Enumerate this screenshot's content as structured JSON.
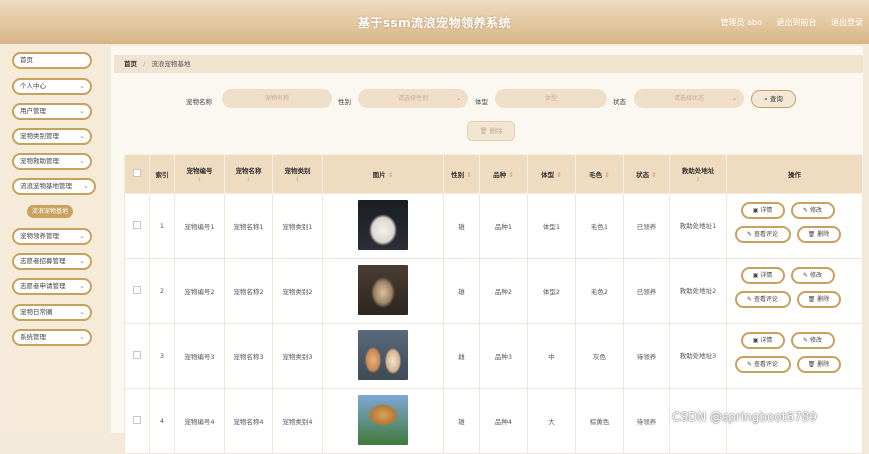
{
  "header": {
    "title": "基于ssm流浪宠物领养系统",
    "links": [
      "管理员 abo",
      "退出到前台",
      "退出登录"
    ]
  },
  "sidebar": {
    "items": [
      {
        "label": "首页",
        "has_chevron": false
      },
      {
        "label": "个人中心",
        "has_chevron": true
      },
      {
        "label": "用户管理",
        "has_chevron": true
      },
      {
        "label": "宠物类别管理",
        "has_chevron": true
      },
      {
        "label": "宠物救助管理",
        "has_chevron": true
      },
      {
        "label": "流浪宠物基地管理",
        "has_chevron": true
      },
      {
        "label": "宠物领养管理",
        "has_chevron": true
      },
      {
        "label": "志愿者招募管理",
        "has_chevron": true
      },
      {
        "label": "志愿者申请管理",
        "has_chevron": true
      },
      {
        "label": "宠物日常圈",
        "has_chevron": true
      },
      {
        "label": "系统管理",
        "has_chevron": true
      }
    ],
    "active_subitem": "流浪宠物基地"
  },
  "breadcrumb": {
    "home": "首页",
    "sep": "/",
    "current": "流浪宠物基地"
  },
  "search": {
    "name_label": "宠物名称",
    "name_placeholder": "宠物名称",
    "gender_label": "性别",
    "gender_placeholder": "请选择性别",
    "size_label": "体型",
    "size_placeholder": "体型",
    "status_label": "状态",
    "status_placeholder": "请选择状态",
    "query_button": "查询"
  },
  "toolbar": {
    "delete_button": "删除"
  },
  "table": {
    "columns": [
      "索引",
      "宠物编号",
      "宠物名称",
      "宠物类别",
      "图片",
      "性别",
      "品种",
      "体型",
      "毛色",
      "状态",
      "救助处地址",
      "操作"
    ],
    "rows": [
      {
        "index": "1",
        "code": "宠物编号1",
        "name": "宠物名称1",
        "category": "宠物类别1",
        "gender": "雄",
        "breed": "品种1",
        "size": "体型1",
        "color": "毛色1",
        "status": "已领养",
        "address": "救助处地址1"
      },
      {
        "index": "2",
        "code": "宠物编号2",
        "name": "宠物名称2",
        "category": "宠物类别2",
        "gender": "雄",
        "breed": "品种2",
        "size": "体型2",
        "color": "毛色2",
        "status": "已领养",
        "address": "救助处地址2"
      },
      {
        "index": "3",
        "code": "宠物编号3",
        "name": "宠物名称3",
        "category": "宠物类别3",
        "gender": "雌",
        "breed": "品种3",
        "size": "中",
        "color": "灰色",
        "status": "待领养",
        "address": "救助处地址3"
      },
      {
        "index": "4",
        "code": "宠物编号4",
        "name": "宠物名称4",
        "category": "宠物类别4",
        "gender": "雄",
        "breed": "品种4",
        "size": "大",
        "color": "棕黄色",
        "status": "待领养",
        "address": ""
      }
    ],
    "actions": {
      "detail": "详情",
      "edit": "修改",
      "view_comments": "查看评论",
      "delete": "删除"
    }
  },
  "watermark": "CSDN @springboot6789",
  "colors": {
    "accent": "#c9a15e",
    "header_bg": "#efdcc0",
    "sidebar_bg": "#f6ebd8"
  }
}
